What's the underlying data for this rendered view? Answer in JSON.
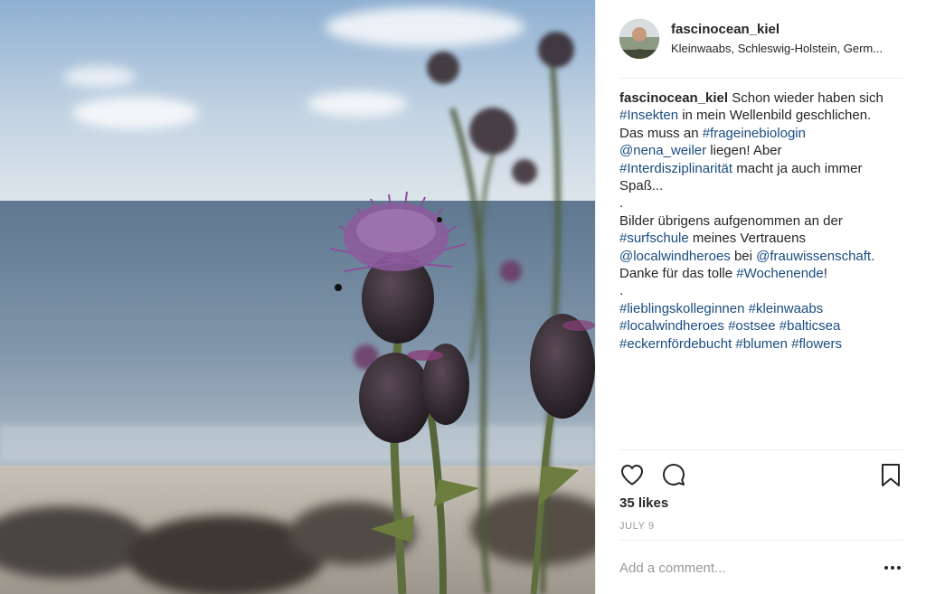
{
  "post": {
    "username": "fascinocean_kiel",
    "location": "Kleinwaabs, Schleswig-Holstein, Germ...",
    "caption_lines": [
      [
        {
          "t": "fascinocean_kiel",
          "k": "user"
        },
        {
          "t": " Schon wieder haben sich",
          "k": "text"
        }
      ],
      [
        {
          "t": "#Insekten",
          "k": "tag"
        },
        {
          "t": " in mein Wellenbild geschlichen.",
          "k": "text"
        }
      ],
      [
        {
          "t": "Das muss an ",
          "k": "text"
        },
        {
          "t": "#frageinebiologin",
          "k": "tag"
        }
      ],
      [
        {
          "t": "@nena_weiler",
          "k": "tag"
        },
        {
          "t": " liegen! Aber",
          "k": "text"
        }
      ],
      [
        {
          "t": "#Interdisziplinarität",
          "k": "tag"
        },
        {
          "t": " macht ja auch immer",
          "k": "text"
        }
      ],
      [
        {
          "t": "Spaß...",
          "k": "text"
        }
      ],
      [
        {
          "t": ".",
          "k": "text"
        }
      ],
      [
        {
          "t": "Bilder übrigens aufgenommen an der",
          "k": "text"
        }
      ],
      [
        {
          "t": "#surfschule",
          "k": "tag"
        },
        {
          "t": " meines Vertrauens",
          "k": "text"
        }
      ],
      [
        {
          "t": "@localwindheroes",
          "k": "tag"
        },
        {
          "t": " bei ",
          "k": "text"
        },
        {
          "t": "@frauwissenschaft",
          "k": "tag"
        },
        {
          "t": ".",
          "k": "text"
        }
      ],
      [
        {
          "t": "Danke für das tolle ",
          "k": "text"
        },
        {
          "t": "#Wochenende",
          "k": "tag"
        },
        {
          "t": "!",
          "k": "text"
        }
      ],
      [
        {
          "t": ".",
          "k": "text"
        }
      ],
      [
        {
          "t": "#lieblingskolleginnen",
          "k": "tag"
        },
        {
          "t": " ",
          "k": "text"
        },
        {
          "t": "#kleinwaabs",
          "k": "tag"
        }
      ],
      [
        {
          "t": "#localwindheroes",
          "k": "tag"
        },
        {
          "t": " ",
          "k": "text"
        },
        {
          "t": "#ostsee",
          "k": "tag"
        },
        {
          "t": " ",
          "k": "text"
        },
        {
          "t": "#balticsea",
          "k": "tag"
        }
      ],
      [
        {
          "t": "#eckernfördebucht",
          "k": "tag"
        },
        {
          "t": " ",
          "k": "text"
        },
        {
          "t": "#blumen",
          "k": "tag"
        },
        {
          "t": " ",
          "k": "text"
        },
        {
          "t": "#flowers",
          "k": "tag"
        }
      ]
    ],
    "likes_text": "35 likes",
    "date_text": "JULY 9",
    "comment_placeholder": "Add a comment..."
  },
  "icons": {
    "like": "heart-icon",
    "comment": "speech-bubble-icon",
    "save": "bookmark-icon",
    "more": "more-options-icon"
  },
  "colors": {
    "hashtag": "#1a4c80",
    "text": "#262626",
    "muted": "#999999",
    "divider": "#efefef"
  }
}
